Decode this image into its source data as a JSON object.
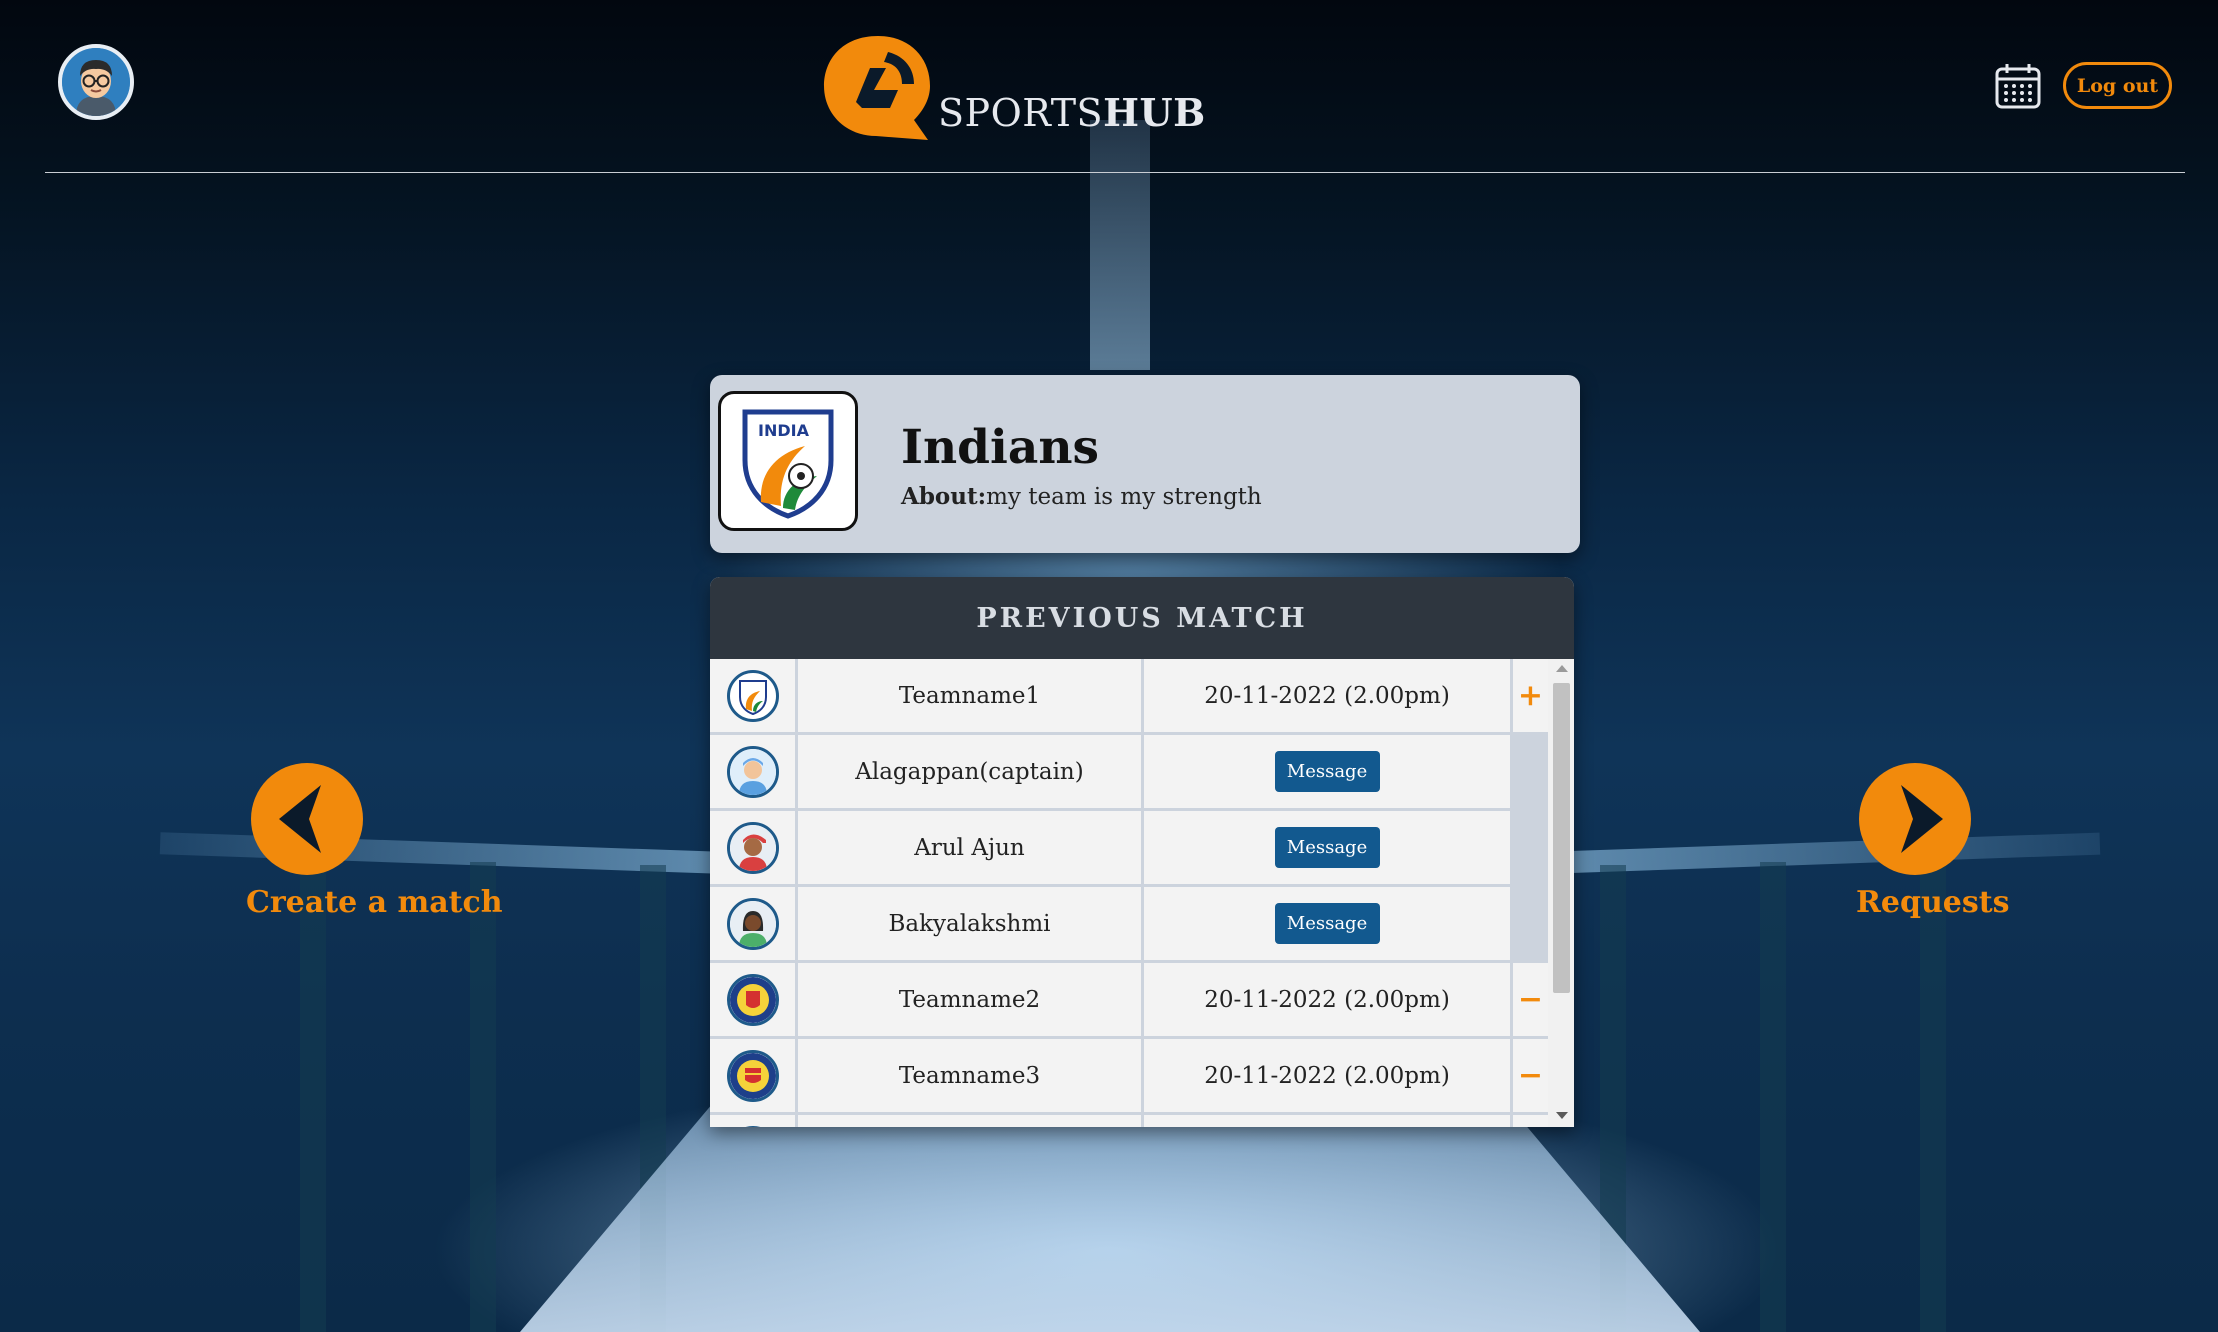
{
  "header": {
    "logo_text_light": "SPORTS",
    "logo_text_bold": "HUB",
    "logout_label": "Log out",
    "avatar_icon": "user-avatar-glasses",
    "calendar_icon": "calendar-icon"
  },
  "team": {
    "name": "Indians",
    "about_label": "About:",
    "about_text": "my team is my strength",
    "logo_text": "INDIA"
  },
  "matches": {
    "heading": "PREVIOUS MATCH",
    "message_label": "Message",
    "rows": [
      {
        "name": "Teamname1",
        "date": "20-11-2022 (2.00pm)",
        "action": "+",
        "icon": "india-badge-icon"
      },
      {
        "name": "Alagappan(captain)",
        "button": "Message",
        "icon": "player-avatar-icon"
      },
      {
        "name": "Arul Ajun",
        "button": "Message",
        "icon": "player-avatar-icon"
      },
      {
        "name": "Bakyalakshmi",
        "button": "Message",
        "icon": "player-avatar-icon"
      },
      {
        "name": "Teamname2",
        "date": "20-11-2022 (2.00pm)",
        "action": "−",
        "icon": "team-crest-icon"
      },
      {
        "name": "Teamname3",
        "date": "20-11-2022 (2.00pm)",
        "action": "−",
        "icon": "team-crest-icon"
      }
    ]
  },
  "nav": {
    "left_label": "Create a match",
    "right_label": "Requests"
  },
  "colors": {
    "accent": "#f28a0c",
    "card": "#ccd3dd",
    "table_header": "#2e363f",
    "message_button": "#12598f"
  }
}
